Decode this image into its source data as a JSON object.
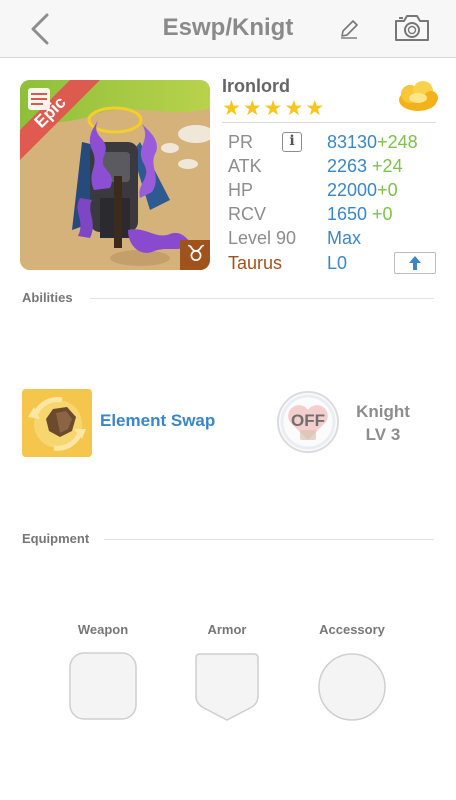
{
  "nav": {
    "title": "Eswp/Knigt"
  },
  "character": {
    "name": "Ironlord",
    "rarity_badge": "Epic",
    "star_count": 5,
    "stars": [
      "★",
      "★",
      "★",
      "★",
      "★"
    ],
    "zodiac_symbol": "♉",
    "colors": {
      "star": "#f6c51e",
      "value_blue": "#3a86c6",
      "bonus_green": "#7cc24b",
      "taurus_brown": "#a0521d",
      "epic_red": "#e0554f"
    }
  },
  "stats": {
    "pr": {
      "label": "PR",
      "info_glyph": "i",
      "value": "83130",
      "bonus": "+248"
    },
    "atk": {
      "label": "ATK",
      "value": "2263",
      "bonus": " +24"
    },
    "hp": {
      "label": "HP",
      "value": "22000",
      "bonus": "+0"
    },
    "rcv": {
      "label": "RCV",
      "value": "1650",
      "bonus": " +0"
    },
    "level": {
      "label": "Level 90",
      "value": "Max"
    },
    "zodiac": {
      "label": "Taurus",
      "value": "L0"
    }
  },
  "abilities": {
    "section_title": "Abilities",
    "skill_name": "Element Swap",
    "leader_toggle": "OFF",
    "job": "Knight",
    "job_level": "LV 3"
  },
  "equipment": {
    "section_title": "Equipment",
    "weapon_label": "Weapon",
    "armor_label": "Armor",
    "accessory_label": "Accessory"
  },
  "icons": [
    "back-chevron-icon",
    "pencil-icon",
    "camera-icon",
    "gold-cloud-icon",
    "info-icon",
    "upload-arrow-icon",
    "taurus-icon",
    "element-swap-icon",
    "heart-off-icon"
  ]
}
